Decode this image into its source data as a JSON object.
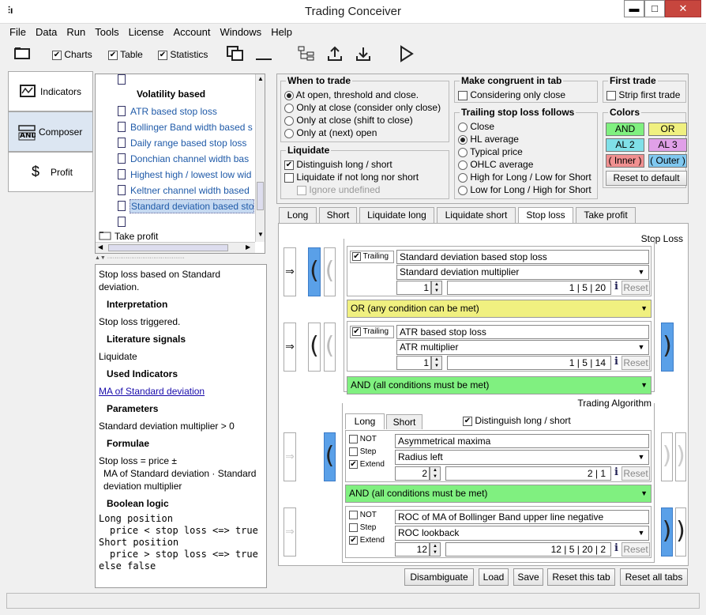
{
  "window": {
    "title": "Trading Conceiver",
    "min": "▬",
    "max": "□",
    "close": "✕"
  },
  "menu": [
    "File",
    "Data",
    "Run",
    "Tools",
    "License",
    "Account",
    "Windows",
    "Help"
  ],
  "toolbar": {
    "charts": "Charts",
    "table": "Table",
    "statistics": "Statistics"
  },
  "side_tabs": [
    "Indicators",
    "Composer",
    "Profit"
  ],
  "tree": {
    "group": "Volatility based",
    "items": [
      "ATR based stop loss",
      "Bollinger Band width based s",
      "Daily range based stop loss",
      "Donchian channel width bas",
      "Highest high / lowest low wid",
      "Keltner channel width based",
      "Standard deviation based sto"
    ],
    "folder": "Take profit"
  },
  "desc": {
    "intro": "Stop loss based on Standard deviation.",
    "h_interp": "Interpretation",
    "interp": "Stop loss triggered.",
    "h_lit": "Literature signals",
    "lit": "Liquidate",
    "h_used": "Used Indicators",
    "used": "MA of Standard deviation",
    "h_params": "Parameters",
    "params": "Standard deviation multiplier > 0",
    "h_formulae": "Formulae",
    "formula1": "Stop loss = price ±",
    "formula2": "MA of Standard deviation · Standard deviation multiplier",
    "h_bool": "Boolean logic",
    "bool1": "Long position",
    "bool2": "price < stop loss <=> true",
    "bool3": "Short position",
    "bool4": "price > stop loss <=> true",
    "bool5": "else false"
  },
  "when": {
    "title": "When to trade",
    "opts": [
      "At open, threshold and close.",
      "Only at close (consider only close)",
      "Only at close (shift to close)",
      "Only at (next) open"
    ]
  },
  "liquidate": {
    "title": "Liquidate",
    "o1": "Distinguish long / short",
    "o2": "Liquidate if not long nor short",
    "o3": "Ignore undefined"
  },
  "congruent": {
    "title": "Make congruent in tab",
    "o1": "Considering only close"
  },
  "trailing": {
    "title": "Trailing stop loss follows",
    "opts": [
      "Close",
      "HL average",
      "Typical price",
      "OHLC average",
      "High for Long / Low for Short",
      "Low for Long / High for Short"
    ]
  },
  "first": {
    "title": "First trade",
    "o1": "Strip first trade"
  },
  "colors": {
    "title": "Colors",
    "and": "AND",
    "or": "OR",
    "al2": "AL 2",
    "al3": "AL 3",
    "inner": "( Inner )",
    "outer": "( Outer )",
    "reset": "Reset to default",
    "and_c": "#80f080",
    "or_c": "#f0f080",
    "al2_c": "#80e0e8",
    "al3_c": "#e0a0e8",
    "inner_c": "#f09090",
    "outer_c": "#80c8f0"
  },
  "subtabs": [
    "Long",
    "Short",
    "Liquidate long",
    "Liquidate short",
    "Stop loss",
    "Take profit"
  ],
  "stoploss": {
    "title": "Stop Loss",
    "c1": {
      "trailing": "Trailing",
      "name": "Standard deviation based stop loss",
      "param": "Standard deviation multiplier",
      "val": "1",
      "range": "1 | 5 | 20"
    },
    "op1": "OR   (any condition can be met)",
    "c2": {
      "trailing": "Trailing",
      "name": "ATR based stop loss",
      "param": "ATR multiplier",
      "val": "1",
      "range": "1 | 5 | 14"
    },
    "op2": "AND   (all conditions must be met)"
  },
  "algo": {
    "title": "Trading Algorithm",
    "tab_long": "Long",
    "tab_short": "Short",
    "distinguish": "Distinguish long / short",
    "c1": {
      "not": "NOT",
      "step": "Step",
      "extend": "Extend",
      "name": "Asymmetrical maxima",
      "param": "Radius left",
      "val": "2",
      "range": "2 | 1"
    },
    "op": "AND   (all conditions must be met)",
    "c2": {
      "not": "NOT",
      "step": "Step",
      "extend": "Extend",
      "name": "ROC of MA of Bollinger Band upper line negative",
      "param": "ROC lookback",
      "val": "12",
      "range": "12 | 5 | 20 | 2"
    }
  },
  "common": {
    "reset": "Reset",
    "info": "i"
  },
  "bottom": {
    "disambiguate": "Disambiguate",
    "load": "Load",
    "save": "Save",
    "reset_tab": "Reset this tab",
    "reset_all": "Reset all tabs"
  }
}
